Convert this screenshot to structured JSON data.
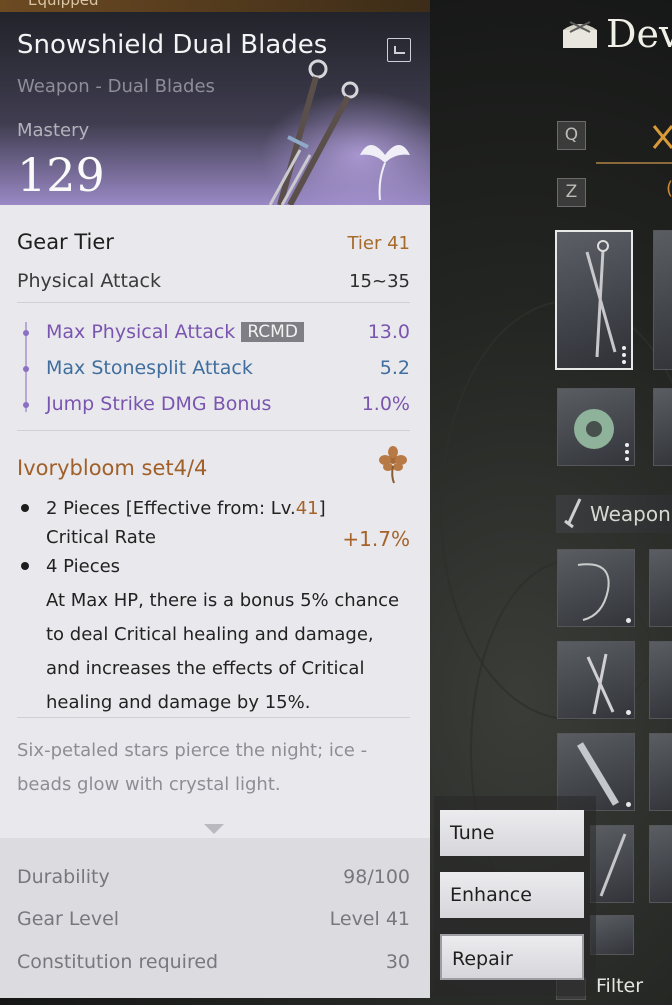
{
  "tooltip": {
    "status": "Equipped",
    "item_name": "Snowshield Dual Blades",
    "item_type": "Weapon - Dual Blades",
    "mastery_label": "Mastery",
    "mastery_value": "129",
    "gear_tier_label": "Gear Tier",
    "gear_tier_value": "Tier 41",
    "physical_attack_label": "Physical Attack",
    "physical_attack_value": "15~35",
    "sub_stats": [
      {
        "label": "Max Physical Attack",
        "tag": "RCMD",
        "value": "13.0",
        "color": "#7a55b0"
      },
      {
        "label": "Max Stonesplit Attack",
        "value": "5.2",
        "color": "#3f6e9e"
      },
      {
        "label": "Jump Strike DMG Bonus",
        "value": "1.0%",
        "color": "#7a55b0"
      }
    ],
    "set": {
      "title": "Ivorybloom set4/4",
      "piece2_label": "2 Pieces [Effective from: Lv.",
      "piece2_level": "41",
      "piece2_close": "]",
      "piece2_stat": "Critical Rate",
      "piece2_stat_value": "+1.7%",
      "piece4_label": "4 Pieces",
      "piece4_desc": "At Max HP, there is a bonus 5% chance to deal Critical healing and damage, and increases the effects of Critical healing and damage by 15%."
    },
    "lore": "Six-petaled stars pierce the night; ice -beads glow with crystal light.",
    "durability_label": "Durability",
    "durability_value": "98/100",
    "gear_level_label": "Gear Level",
    "gear_level_value": "Level 41",
    "constitution_label": "Constitution required",
    "constitution_value": "30"
  },
  "context_menu": {
    "items": [
      "Tune",
      "Enhance",
      "Repair"
    ]
  },
  "right_panel": {
    "title_fragment": "Dev",
    "key_q": "Q",
    "key_z": "Z",
    "z_fragment": "(",
    "weapons_fragment": "Weapon",
    "filter_label": "Filter"
  },
  "colors": {
    "accent_gold": "#a5632a",
    "stat_purple": "#7a55b0",
    "stat_blue": "#3f6e9e"
  }
}
